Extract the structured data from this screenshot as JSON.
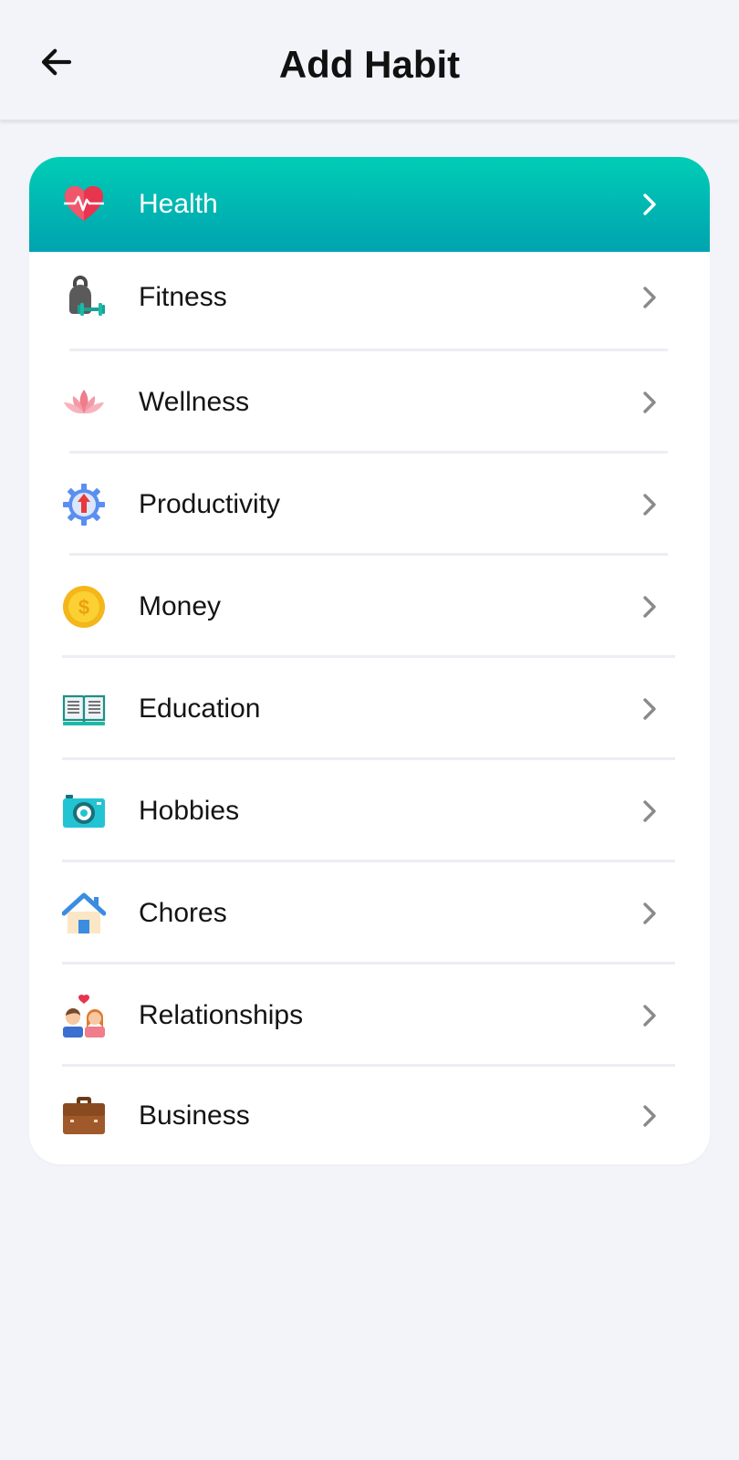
{
  "header": {
    "title": "Add Habit",
    "back_icon": "arrow-left-icon"
  },
  "colors": {
    "background": "#f2f4f9",
    "active_gradient_top": "#00cdb5",
    "active_gradient_bottom": "#00a3b0",
    "chevron": "#8a8a8a"
  },
  "categories": [
    {
      "label": "Health",
      "icon": "heart-pulse-icon",
      "active": true
    },
    {
      "label": "Fitness",
      "icon": "kettlebell-dumbbell-icon",
      "active": false
    },
    {
      "label": "Wellness",
      "icon": "lotus-icon",
      "active": false
    },
    {
      "label": "Productivity",
      "icon": "gear-arrow-up-icon",
      "active": false
    },
    {
      "label": "Money",
      "icon": "coin-icon",
      "active": false
    },
    {
      "label": "Education",
      "icon": "open-book-icon",
      "active": false
    },
    {
      "label": "Hobbies",
      "icon": "camera-icon",
      "active": false
    },
    {
      "label": "Chores",
      "icon": "house-icon",
      "active": false
    },
    {
      "label": "Relationships",
      "icon": "couple-icon",
      "active": false
    },
    {
      "label": "Business",
      "icon": "briefcase-icon",
      "active": false
    }
  ]
}
